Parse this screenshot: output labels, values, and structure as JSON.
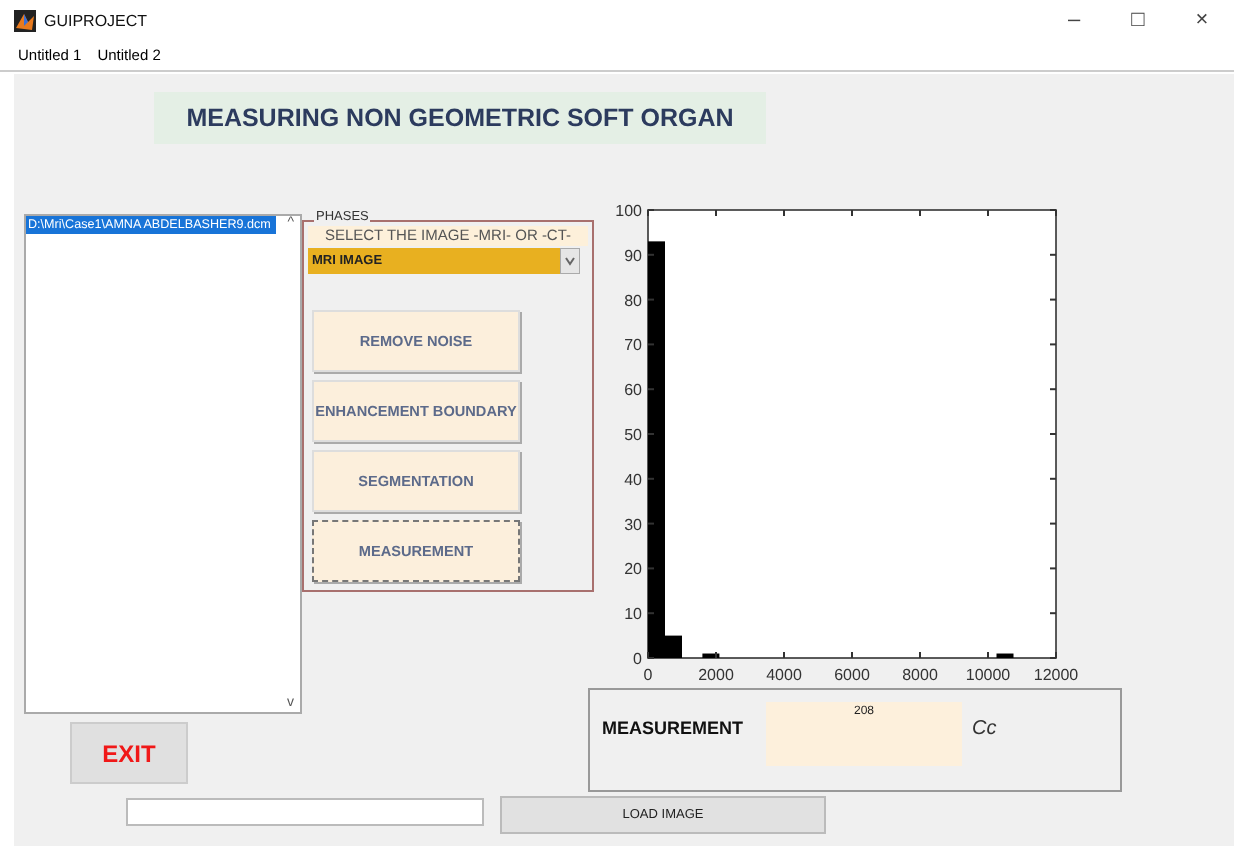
{
  "window": {
    "title": "GUIPROJECT",
    "controls": [
      "–",
      "□",
      "×"
    ]
  },
  "menu": [
    "Untitled 1",
    "Untitled 2"
  ],
  "banner": "MEASURING NON GEOMETRIC SOFT ORGAN",
  "file_list": {
    "items": [
      {
        "label": "D:\\Mri\\Case1\\AMNA ABDELBASHER9.dcm",
        "selected": true
      }
    ],
    "scroll_up": "^",
    "scroll_down": "v"
  },
  "phases": {
    "title": "PHASES",
    "prompt": "SELECT THE IMAGE -MRI- OR -CT-",
    "dropdown": {
      "value": "MRI IMAGE"
    },
    "buttons": [
      {
        "label": "REMOVE NOISE",
        "focused": false
      },
      {
        "label": "ENHANCEMENT BOUNDARY",
        "focused": false
      },
      {
        "label": "SEGMENTATION",
        "focused": false
      },
      {
        "label": "MEASUREMENT",
        "focused": true
      }
    ]
  },
  "histogram": {
    "chart_data": {
      "type": "bar",
      "x": [
        250,
        750,
        1850,
        10500
      ],
      "values": [
        93,
        5,
        1,
        1
      ],
      "xlim": [
        0,
        12000
      ],
      "ylim": [
        0,
        100
      ],
      "xticks": [
        0,
        2000,
        4000,
        6000,
        8000,
        10000,
        12000
      ],
      "yticks": [
        0,
        10,
        20,
        30,
        40,
        50,
        60,
        70,
        80,
        90,
        100
      ]
    }
  },
  "measurement": {
    "label": "MEASUREMENT",
    "value": "208",
    "unit": "Cc"
  },
  "exit_button": "EXIT",
  "load_button": "LOAD IMAGE"
}
